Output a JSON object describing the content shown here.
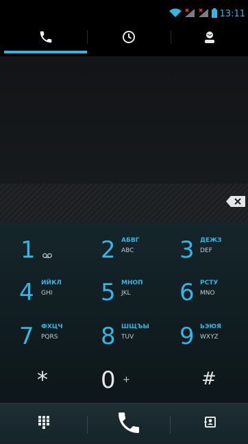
{
  "status_bar": {
    "time": "13:11",
    "icons": [
      "wifi-icon",
      "signal-1-icon",
      "signal-2-icon",
      "battery-icon"
    ]
  },
  "tabs": [
    {
      "id": "phone",
      "icon": "phone-icon",
      "selected": true
    },
    {
      "id": "recent",
      "icon": "clock-icon",
      "selected": false
    },
    {
      "id": "contacts",
      "icon": "person-icon",
      "selected": false
    }
  ],
  "dialer": {
    "number": "",
    "backspace_icon": "backspace-icon"
  },
  "keypad": {
    "keys": [
      {
        "digit": "1",
        "letters_ru": "",
        "letters": "",
        "icon": "voicemail-icon"
      },
      {
        "digit": "2",
        "letters_ru": "АБВГ",
        "letters": "ABC"
      },
      {
        "digit": "3",
        "letters_ru": "ДЕЖЗ",
        "letters": "DEF"
      },
      {
        "digit": "4",
        "letters_ru": "ИЙКЛ",
        "letters": "GHI"
      },
      {
        "digit": "5",
        "letters_ru": "МНОП",
        "letters": "JKL"
      },
      {
        "digit": "6",
        "letters_ru": "РСТУ",
        "letters": "MNO"
      },
      {
        "digit": "7",
        "letters_ru": "ФХЦЧ",
        "letters": "PQRS"
      },
      {
        "digit": "8",
        "letters_ru": "ШЩЪЫ",
        "letters": "TUV"
      },
      {
        "digit": "9",
        "letters_ru": "ЬЭЮЯ",
        "letters": "WXYZ"
      },
      {
        "digit": "*",
        "letters_ru": "",
        "letters": ""
      },
      {
        "digit": "0",
        "letters_ru": "",
        "letters": "+"
      },
      {
        "digit": "#",
        "letters_ru": "",
        "letters": ""
      }
    ]
  },
  "action_bar": {
    "left_icon": "dialpad-icon",
    "center_icon": "call-icon",
    "right_icon": "add-contact-icon"
  },
  "colors": {
    "accent": "#33b5e5",
    "background": "#0b0c0e",
    "keypad_bg": "#15262b"
  }
}
